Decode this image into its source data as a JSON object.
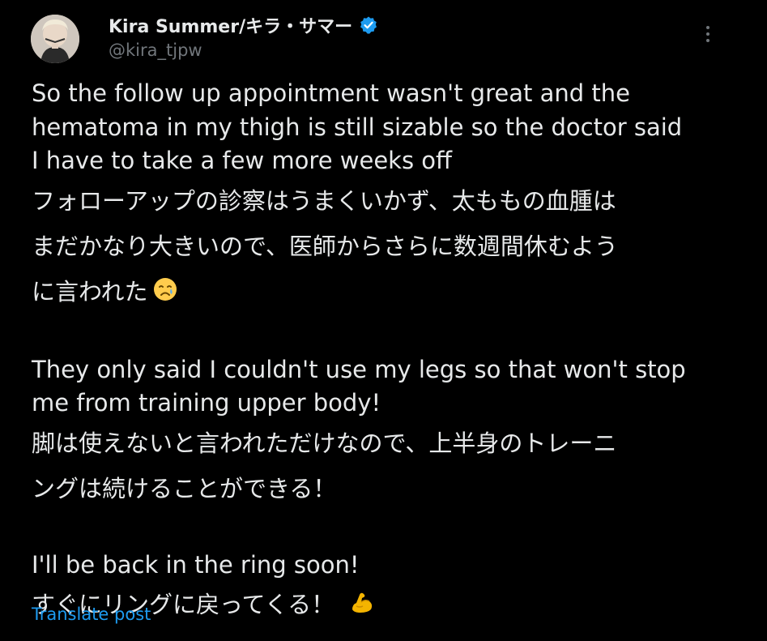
{
  "author": {
    "display_name": "Kira Summer/キラ・サマー",
    "handle": "@kira_tjpw",
    "verified": true,
    "avatar_icon": "avatar-photo",
    "verified_icon": "verified-badge-icon",
    "more_icon": "more-options-icon"
  },
  "post": {
    "en_1": [
      "So the follow up appointment wasn't great and the",
      "hematoma in my thigh is still sizable so the doctor said",
      "I have to take a few more weeks off"
    ],
    "jp_1": [
      "フォローアップの診察はうまくいかず、太ももの血腫は",
      "まだかなり大きいので、医師からさらに数週間休むよう",
      "に言われた"
    ],
    "jp_1_emoji": "crying-face-emoji",
    "en_2": [
      "They only said I couldn't use my legs so that won't stop",
      "me from training upper body!"
    ],
    "jp_2": [
      "脚は使えないと言われただけなので、上半身のトレーニ",
      "ングは続けることができる！"
    ],
    "en_3": [
      "I'll be back in the ring soon!"
    ],
    "jp_3": [
      "すぐにリングに戻ってくる！"
    ],
    "jp_3_emoji": "flexed-biceps-emoji"
  },
  "translate_label": "Translate post",
  "colors": {
    "background": "#000000",
    "text": "#e7e9ea",
    "secondary": "#71767b",
    "accent": "#1d9bf0"
  }
}
